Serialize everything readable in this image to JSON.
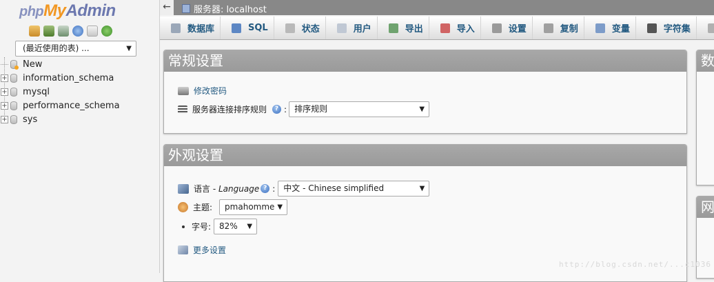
{
  "nav": {
    "logo_php": "php",
    "logo_my": "My",
    "logo_admin": "Admin",
    "icons": [
      "home-icon",
      "logout-icon",
      "sql-query-icon",
      "help-icon",
      "docs-icon",
      "reload-icon"
    ],
    "recent_tables": "(最近使用的表) ...",
    "tree": [
      {
        "label": "New",
        "type": "new"
      },
      {
        "label": "information_schema",
        "type": "db"
      },
      {
        "label": "mysql",
        "type": "db"
      },
      {
        "label": "performance_schema",
        "type": "db"
      },
      {
        "label": "sys",
        "type": "db"
      }
    ]
  },
  "topbar": {
    "back": "←",
    "server": "服务器: localhost"
  },
  "tabs": [
    {
      "label": "数据库",
      "icon": "database-icon",
      "color": "#9aa7b8"
    },
    {
      "label": "SQL",
      "icon": "sql-icon",
      "color": "#5d87c4"
    },
    {
      "label": "状态",
      "icon": "status-icon",
      "color": "#b9b9b9"
    },
    {
      "label": "用户",
      "icon": "users-icon",
      "color": "#c0c8d4"
    },
    {
      "label": "导出",
      "icon": "export-icon",
      "color": "#6fa36f"
    },
    {
      "label": "导入",
      "icon": "import-icon",
      "color": "#d06464"
    },
    {
      "label": "设置",
      "icon": "settings-icon",
      "color": "#9a9a9a"
    },
    {
      "label": "复制",
      "icon": "replication-icon",
      "color": "#a0a0a0"
    },
    {
      "label": "变量",
      "icon": "variables-icon",
      "color": "#7d9cc9"
    },
    {
      "label": "字符集",
      "icon": "charset-icon",
      "color": "#555555"
    }
  ],
  "general": {
    "title": "常规设置",
    "change_password": "修改密码",
    "collation_label": "服务器连接排序规则",
    "collation_colon": ":",
    "collation_value": "排序规则"
  },
  "appearance": {
    "title": "外观设置",
    "language_label": "语言",
    "language_dash": " - ",
    "language_en": "Language",
    "language_colon": ":",
    "language_value": "中文 - Chinese simplified",
    "theme_label": "主题:",
    "theme_value": "pmahomme",
    "font_label": "字号:",
    "font_value": "82%",
    "more_settings": "更多设置"
  },
  "right_panels": {
    "top_title": "数",
    "bottom_title": "网"
  },
  "watermark": "http://blog.csdn.net/...c1036"
}
